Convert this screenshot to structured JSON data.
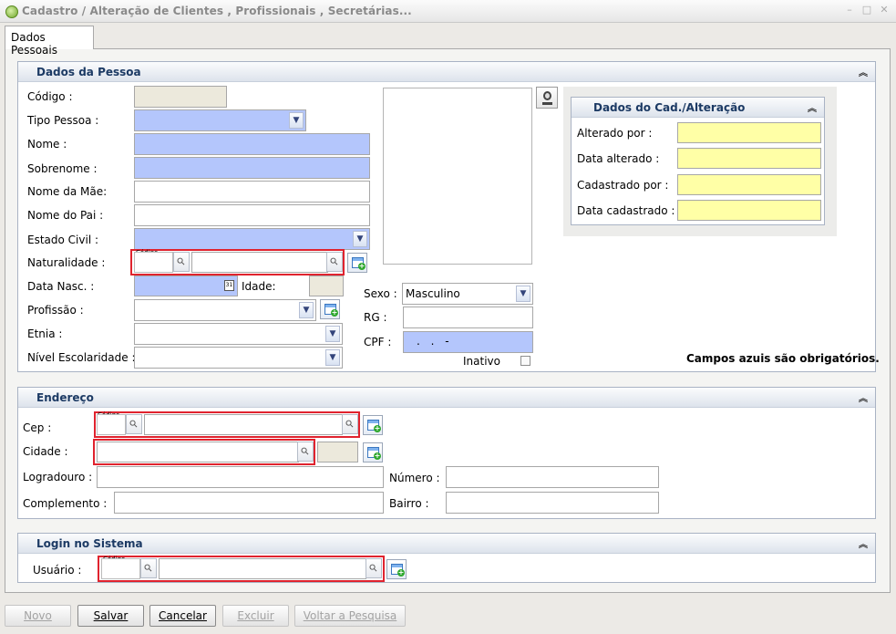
{
  "window": {
    "title": "Cadastro / Alteração de Clientes , Profissionais , Secretárias..."
  },
  "tabs": [
    {
      "label": "Dados Pessoais"
    }
  ],
  "dados_pessoa": {
    "title": "Dados da Pessoa",
    "codigo_label": "Código :",
    "tipo_pessoa_label": "Tipo Pessoa :",
    "nome_label": "Nome :",
    "sobrenome_label": "Sobrenome :",
    "nome_mae_label": "Nome da Mãe:",
    "nome_pai_label": "Nome do Pai :",
    "estado_civil_label": "Estado Civil :",
    "naturalidade_label": "Naturalidade :",
    "data_nasc_label": "Data Nasc. :",
    "idade_label": "Idade:",
    "profissao_label": "Profissão :",
    "etnia_label": "Etnia :",
    "nivel_escolaridade_label": "Nível Escolaridade :",
    "sexo_label": "Sexo :",
    "sexo_value": "Masculino",
    "rg_label": "RG :",
    "cpf_label": "CPF :",
    "cpf_mask": ". . -",
    "inativo_label": "Inativo",
    "required_note": "Campos azuis são obrigatórios.",
    "codigo_hint": "Código"
  },
  "dados_cad": {
    "title": "Dados do Cad./Alteração",
    "alterado_por_label": "Alterado por :",
    "data_alterado_label": "Data alterado :",
    "cadastrado_por_label": "Cadastrado por :",
    "data_cadastrado_label": "Data cadastrado :"
  },
  "endereco": {
    "title": "Endereço",
    "cep_label": "Cep :",
    "cidade_label": "Cidade :",
    "logradouro_label": "Logradouro :",
    "numero_label": "Número :",
    "complemento_label": "Complemento :",
    "bairro_label": "Bairro :",
    "codigo_hint": "Código"
  },
  "login": {
    "title": "Login no Sistema",
    "usuario_label": "Usuário :",
    "codigo_hint": "Código"
  },
  "buttons": {
    "novo": "Novo",
    "salvar": "Salvar",
    "cancelar": "Cancelar",
    "excluir": "Excluir",
    "voltar": "Voltar a Pesquisa"
  },
  "icons": {
    "collapse": "double-chevron-up-icon",
    "search": "magnifier-icon",
    "add": "add-record-icon",
    "calendar": "calendar-icon",
    "webcam": "webcam-icon"
  },
  "colors": {
    "required_field": "#b4c6fc",
    "readonly_field": "#ece9dc",
    "audit_field": "#ffffa6",
    "lookup_highlight": "#e0232e",
    "panel_title": "#1c3a64"
  }
}
